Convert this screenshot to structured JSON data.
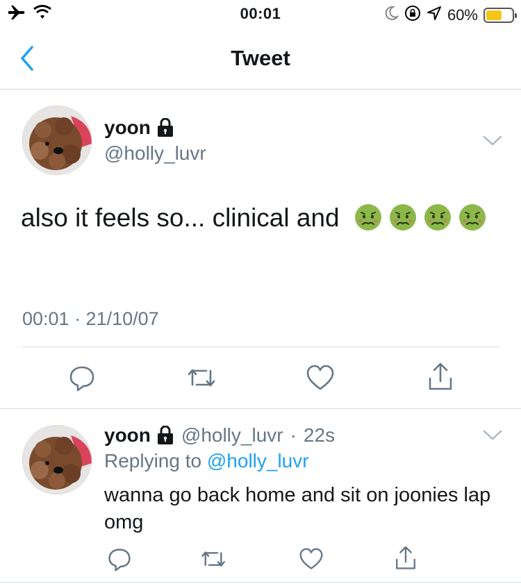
{
  "status_bar": {
    "time": "00:01",
    "battery_percent": "60%",
    "battery_level": 0.6,
    "icons": [
      "airplane-icon",
      "wifi-icon",
      "moon-icon",
      "rotation-lock-icon",
      "location-icon",
      "battery-icon"
    ]
  },
  "nav": {
    "title": "Tweet",
    "back_icon": "chevron-left-icon"
  },
  "main_tweet": {
    "display_name": "yoon",
    "handle": "@holly_luvr",
    "text": "also it feels so... clinical and",
    "emoji": [
      "nauseated-face",
      "nauseated-face",
      "nauseated-face",
      "nauseated-face"
    ],
    "timestamp": "00:01 · 21/10/07",
    "actions": [
      "reply-icon",
      "retweet-icon",
      "like-icon",
      "share-icon"
    ]
  },
  "reply_tweet": {
    "display_name": "yoon",
    "handle": "@holly_luvr",
    "separator": "·",
    "age": "22s",
    "replying_prefix": "Replying to",
    "replying_to": "@holly_luvr",
    "text": "wanna go back home and sit on joonies lap omg",
    "actions": [
      "reply-icon",
      "retweet-icon",
      "like-icon",
      "share-icon"
    ]
  },
  "colors": {
    "accent": "#1da1f2",
    "secondary_text": "#657786",
    "primary_text": "#14171a",
    "battery": "#f5c518"
  }
}
